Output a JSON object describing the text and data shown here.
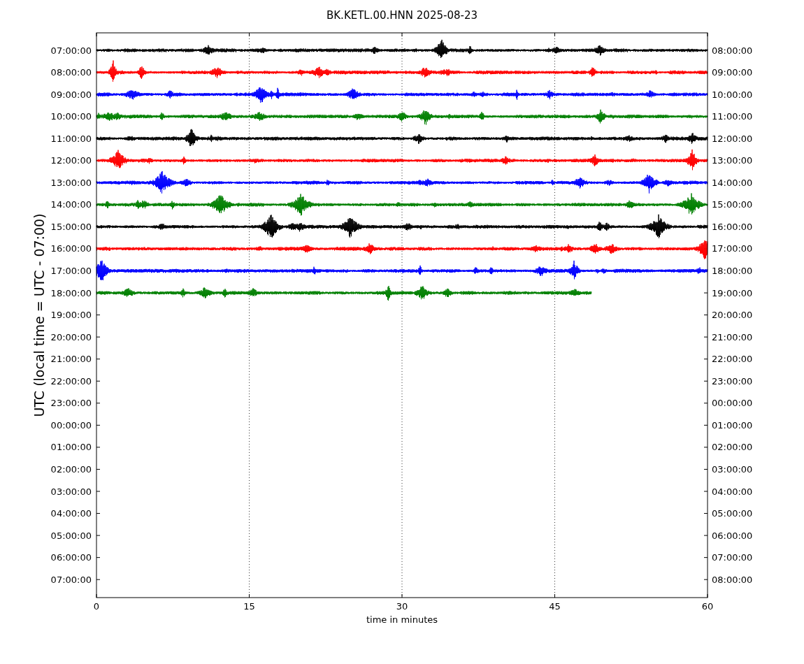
{
  "title": "BK.KETL.00.HNN 2025-08-23",
  "ylabel": "UTC (local time = UTC - 07:00)",
  "xlabel": "time in minutes",
  "xticks": [
    "0",
    "15",
    "30",
    "45",
    "60"
  ],
  "rows": [
    {
      "left": "07:00:00",
      "right": "08:00:00"
    },
    {
      "left": "08:00:00",
      "right": "09:00:00"
    },
    {
      "left": "09:00:00",
      "right": "10:00:00"
    },
    {
      "left": "10:00:00",
      "right": "11:00:00"
    },
    {
      "left": "11:00:00",
      "right": "12:00:00"
    },
    {
      "left": "12:00:00",
      "right": "13:00:00"
    },
    {
      "left": "13:00:00",
      "right": "14:00:00"
    },
    {
      "left": "14:00:00",
      "right": "15:00:00"
    },
    {
      "left": "15:00:00",
      "right": "16:00:00"
    },
    {
      "left": "16:00:00",
      "right": "17:00:00"
    },
    {
      "left": "17:00:00",
      "right": "18:00:00"
    },
    {
      "left": "18:00:00",
      "right": "19:00:00"
    },
    {
      "left": "19:00:00",
      "right": "20:00:00"
    },
    {
      "left": "20:00:00",
      "right": "21:00:00"
    },
    {
      "left": "21:00:00",
      "right": "22:00:00"
    },
    {
      "left": "22:00:00",
      "right": "23:00:00"
    },
    {
      "left": "23:00:00",
      "right": "00:00:00"
    },
    {
      "left": "00:00:00",
      "right": "01:00:00"
    },
    {
      "left": "01:00:00",
      "right": "02:00:00"
    },
    {
      "left": "02:00:00",
      "right": "03:00:00"
    },
    {
      "left": "03:00:00",
      "right": "04:00:00"
    },
    {
      "left": "04:00:00",
      "right": "05:00:00"
    },
    {
      "left": "05:00:00",
      "right": "06:00:00"
    },
    {
      "left": "06:00:00",
      "right": "07:00:00"
    },
    {
      "left": "07:00:00",
      "right": "08:00:00"
    }
  ],
  "traces": [
    {
      "color": "#000000",
      "level": 1
    },
    {
      "color": "#ff0000",
      "level": 1
    },
    {
      "color": "#0000ff",
      "level": 1
    },
    {
      "color": "#008000",
      "level": 1
    },
    {
      "color": "#000000",
      "level": 1
    },
    {
      "color": "#ff0000",
      "level": 1
    },
    {
      "color": "#0000ff",
      "level": 1
    },
    {
      "color": "#008000",
      "level": 1
    },
    {
      "color": "#000000",
      "level": 1
    },
    {
      "color": "#ff0000",
      "level": 1
    },
    {
      "color": "#0000ff",
      "level": 1
    },
    {
      "color": "#008000",
      "level": 0.81
    }
  ]
}
